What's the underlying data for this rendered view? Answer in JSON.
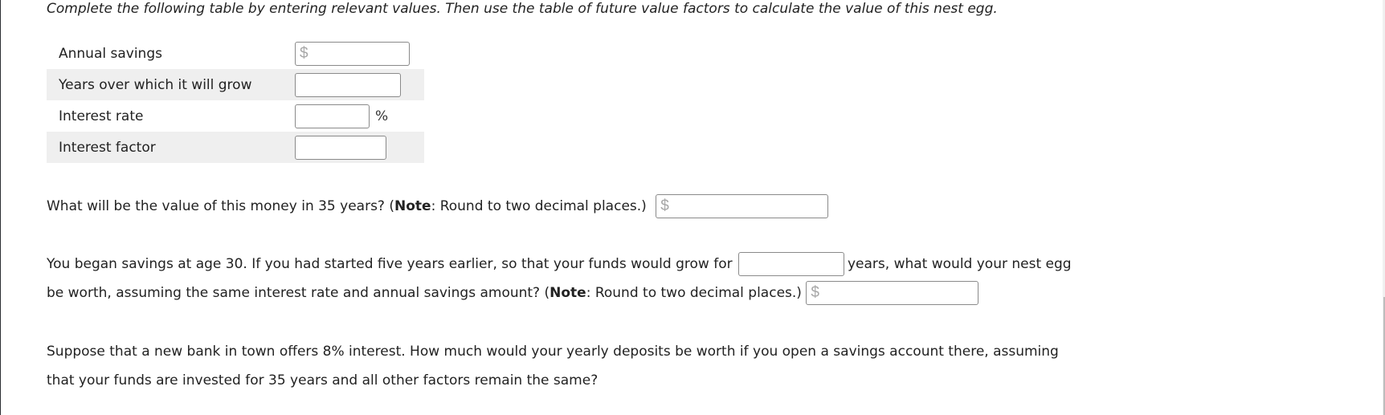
{
  "instruction": "Complete the following table by entering relevant values. Then use the table of future value factors to calculate the value of this nest egg.",
  "table": {
    "rows": [
      {
        "label": "Annual savings",
        "prefix": "$",
        "suffix": "",
        "value": ""
      },
      {
        "label": "Years over which it will grow",
        "prefix": "",
        "suffix": "",
        "value": ""
      },
      {
        "label": "Interest rate",
        "prefix": "",
        "suffix": "%",
        "value": ""
      },
      {
        "label": "Interest factor",
        "prefix": "",
        "suffix": "",
        "value": ""
      }
    ]
  },
  "question1": {
    "text_before": "What will be the value of this money in 35 years? (",
    "note_label": "Note",
    "text_after": ": Round to two decimal places.)",
    "input_prefix": "$",
    "value": ""
  },
  "question2": {
    "line1_before": "You began savings at age 30. If you had started five years earlier, so that your funds would grow for",
    "line1_after": "years, what would your nest egg",
    "line2_before": "be worth, assuming the same interest rate and annual savings amount? (",
    "note_label": "Note",
    "line2_after": ": Round to two decimal places.)",
    "years_value": "",
    "input_prefix": "$",
    "value": ""
  },
  "question3": {
    "line1": "Suppose that a new bank in town offers 8% interest. How much would your yearly deposits be worth if you open a savings account there, assuming",
    "line2": "that your funds are invested for 35 years and all other factors remain the same?"
  }
}
